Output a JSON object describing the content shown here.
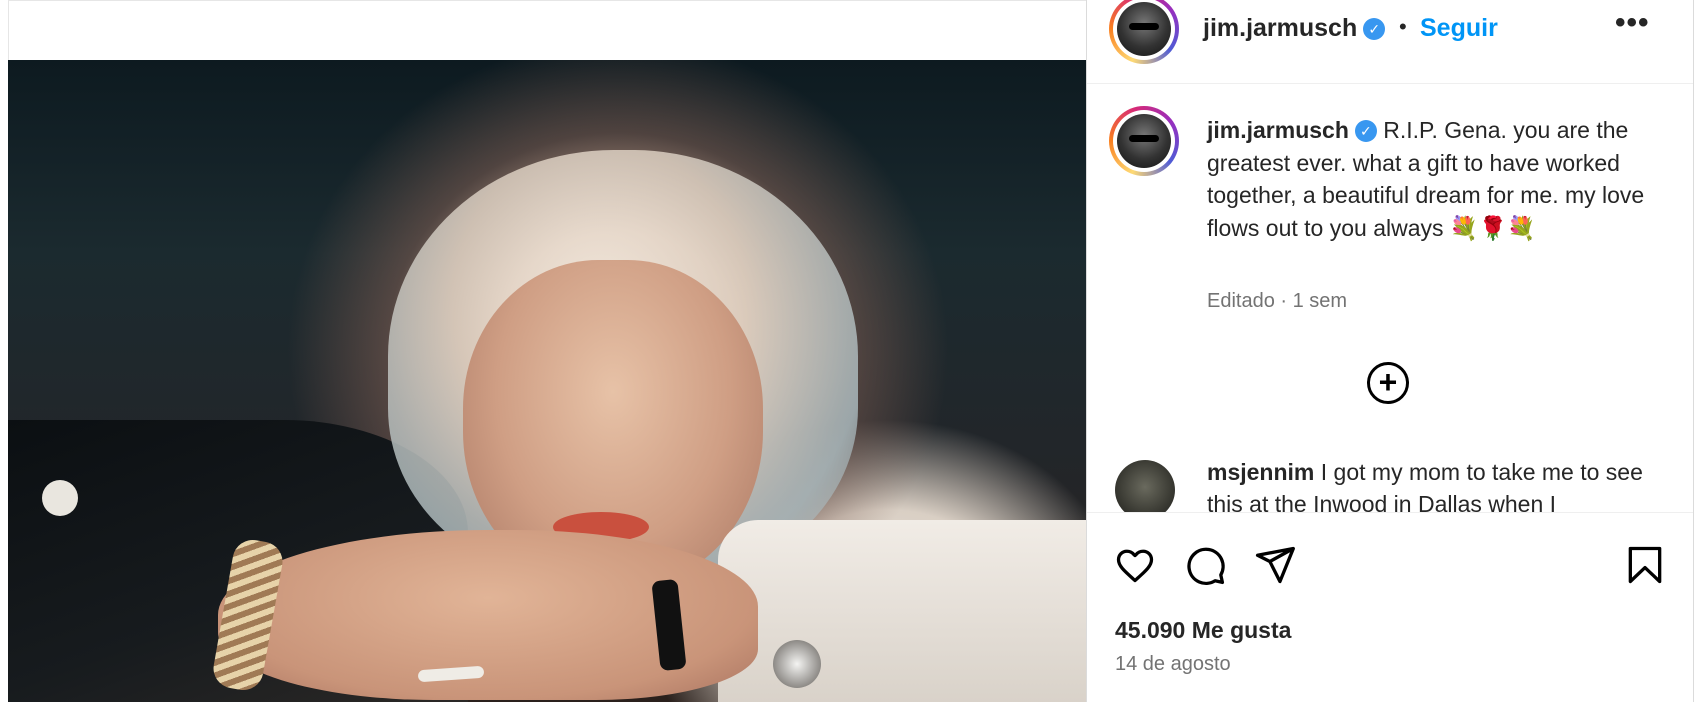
{
  "header": {
    "username": "jim.jarmusch",
    "verified_mark": "✓",
    "separator": "•",
    "follow_label": "Seguir",
    "more_label": "•••"
  },
  "caption": {
    "username": "jim.jarmusch",
    "verified_mark": "✓",
    "text": "R.I.P. Gena. you are the greatest ever. what a gift to have worked together, a beautiful dream for me. my love flows out to you always 💐🌹💐",
    "meta": "Editado · 1 sem"
  },
  "load_more": {
    "symbol": "+"
  },
  "comments": [
    {
      "username": "msjennim",
      "text": "I got my mom to take me to see this at the Inwood in Dallas when I"
    }
  ],
  "actions": {
    "icons": [
      "heart-icon",
      "comment-icon",
      "share-icon",
      "bookmark-icon"
    ]
  },
  "stats": {
    "likes": "45.090 Me gusta",
    "date": "14 de agosto"
  }
}
